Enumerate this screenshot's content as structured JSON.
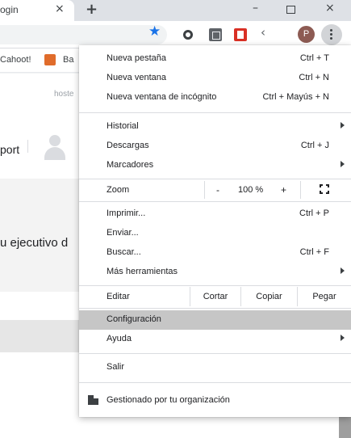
{
  "tab": {
    "title": "ogin",
    "close_glyph": "×",
    "new_tab_glyph": "+"
  },
  "window": {
    "minimize_glyph": "–",
    "close_glyph": "×"
  },
  "toolbar": {
    "star_glyph": "★",
    "avatar_letter": "P",
    "ext_arrow_glyph": "‹"
  },
  "bookmarks": {
    "items": [
      "Cahoot!",
      "Ba"
    ]
  },
  "page": {
    "hoste_text": "hoste",
    "port_text": "port",
    "ejecutivo_text": "u ejecutivo d"
  },
  "menu": {
    "new_tab": {
      "label": "Nueva pestaña",
      "shortcut": "Ctrl + T"
    },
    "new_window": {
      "label": "Nueva ventana",
      "shortcut": "Ctrl + N"
    },
    "incognito": {
      "label": "Nueva ventana de incógnito",
      "shortcut": "Ctrl + Mayús + N"
    },
    "history": {
      "label": "Historial"
    },
    "downloads": {
      "label": "Descargas",
      "shortcut": "Ctrl + J"
    },
    "bookmarks": {
      "label": "Marcadores"
    },
    "zoom": {
      "label": "Zoom",
      "minus": "-",
      "value": "100 %",
      "plus": "+"
    },
    "print": {
      "label": "Imprimir...",
      "shortcut": "Ctrl + P"
    },
    "cast": {
      "label": "Enviar..."
    },
    "find": {
      "label": "Buscar...",
      "shortcut": "Ctrl + F"
    },
    "more_tools": {
      "label": "Más herramientas"
    },
    "edit": {
      "label": "Editar",
      "cut": "Cortar",
      "copy": "Copiar",
      "paste": "Pegar"
    },
    "settings": {
      "label": "Configuración"
    },
    "help": {
      "label": "Ayuda"
    },
    "exit": {
      "label": "Salir"
    },
    "managed": {
      "label": "Gestionado por tu organización"
    }
  },
  "colors": {
    "accent": "#1a73e8",
    "highlight": "#c6c6c6",
    "menu_bg": "#ffffff",
    "toolbar_bg": "#ffffff",
    "tabstrip_bg": "#dee1e6"
  },
  "icons": [
    "star-icon",
    "extension-circle-icon",
    "extension-gray-icon",
    "extension-red-icon",
    "extension-arrow-icon",
    "profile-avatar-icon",
    "menu-kebab-icon",
    "fullscreen-icon",
    "building-icon",
    "user-silhouette-icon"
  ]
}
